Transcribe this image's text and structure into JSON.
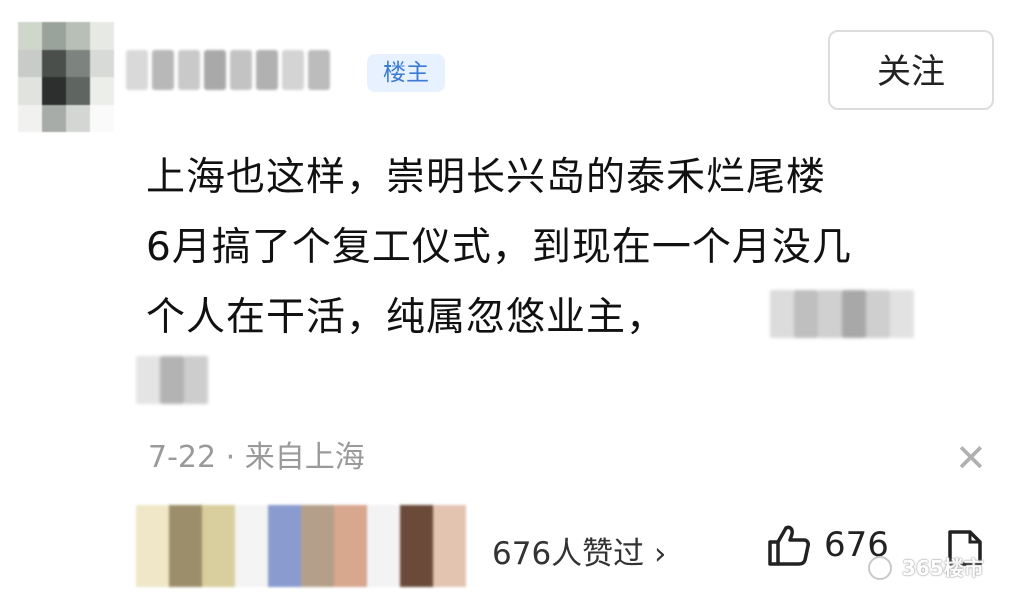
{
  "header": {
    "badge_label": "楼主",
    "follow_label": "关注"
  },
  "comment": {
    "lines": [
      "上海也这样，崇明长兴岛的泰禾烂尾楼",
      "6月搞了个复工仪式，到现在一个月没几",
      "个人在干活，纯属忽悠业主，"
    ]
  },
  "meta": {
    "date": "7-22",
    "separator": "·",
    "location": "来自上海"
  },
  "footer": {
    "likes_text": "676人赞过 ›",
    "thumb_count": "676"
  },
  "watermark": {
    "text": "365楼市"
  },
  "icons": {
    "close": "close-icon",
    "like": "thumbs-up-icon",
    "share": "share-icon"
  }
}
